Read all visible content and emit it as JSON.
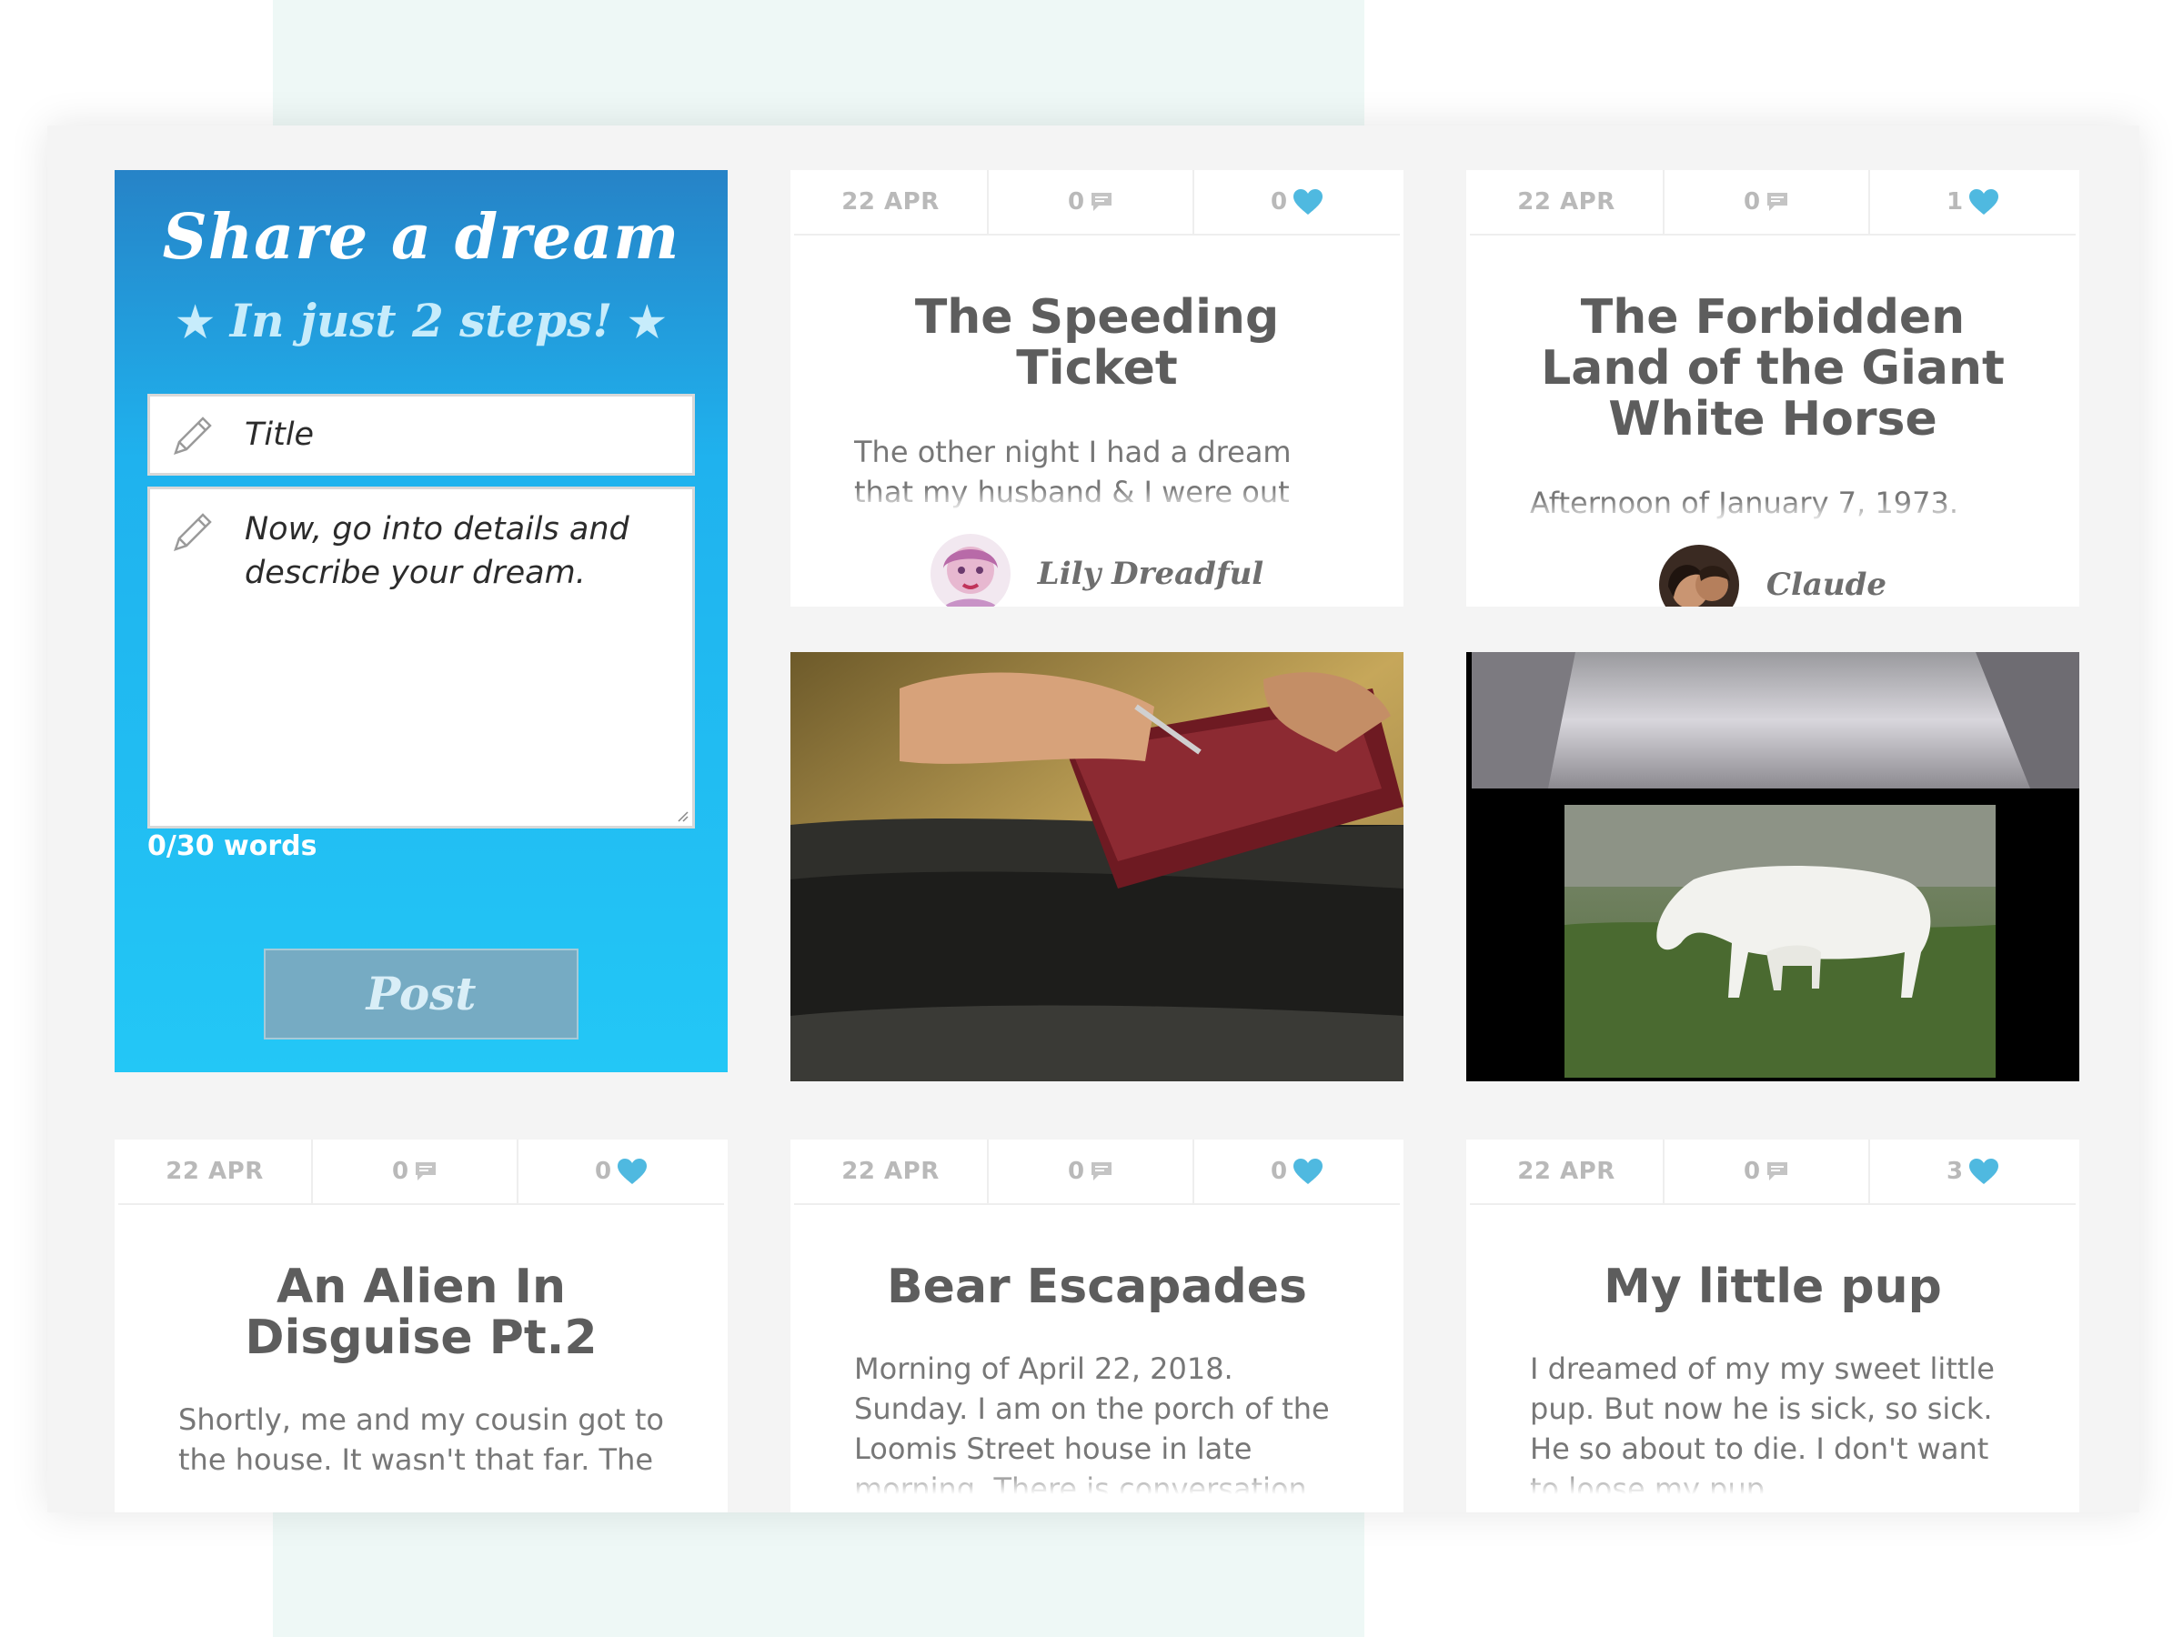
{
  "share": {
    "title": "Share a dream",
    "subtitle": "In just 2 steps!",
    "star": "★",
    "title_placeholder": "Title",
    "body_placeholder": "Now, go into details and describe your dream.",
    "word_count": "0/30 words",
    "post_label": "Post",
    "colors": {
      "gradient_top": "#2683c7",
      "gradient_bottom": "#23c7f6",
      "post_button": "#76abc3"
    }
  },
  "icons": {
    "comment": "comment-icon",
    "like": "heart-icon",
    "edit": "pencil-icon"
  },
  "accent_heart": "#4fb9e0",
  "cards": [
    {
      "date": "22 APR",
      "comments": "0",
      "likes": "0",
      "title": "The Speeding Ticket",
      "excerpt": "The other night I had a dream that my husband & I were out",
      "author": "Lily Dreadful",
      "image": "hands-writing-ticket-photo"
    },
    {
      "date": "22 APR",
      "comments": "0",
      "likes": "1",
      "title": "The Forbidden Land of the Giant White Horse",
      "excerpt": "Afternoon of January 7, 1973.",
      "author": "Claude",
      "image": "white-horse-collage-photo"
    },
    {
      "date": "22 APR",
      "comments": "0",
      "likes": "0",
      "title": "An Alien In Disguise Pt.2",
      "excerpt": "Shortly, me and my cousin got to the house. It wasn't that far. The"
    },
    {
      "date": "22 APR",
      "comments": "0",
      "likes": "0",
      "title": "Bear Escapades",
      "excerpt": "Morning of April 22, 2018. Sunday. I am on the porch of the Loomis Street house in late morning. There is conversation"
    },
    {
      "date": "22 APR",
      "comments": "0",
      "likes": "3",
      "title": "My little pup",
      "excerpt": "I dreamed of my my sweet little pup. But now he is sick, so sick. He so about to die. I don't want to loose my pup"
    }
  ]
}
